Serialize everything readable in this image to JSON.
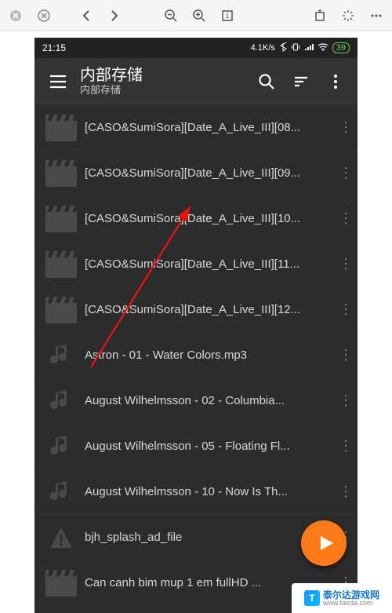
{
  "outer_toolbar": {},
  "status": {
    "time": "21:15",
    "net": "4.1K/s",
    "battery": "39"
  },
  "header": {
    "title": "内部存储",
    "subtitle": "内部存储"
  },
  "files": [
    {
      "type": "video",
      "name": "[CASO&SumiSora][Date_A_Live_III][08..."
    },
    {
      "type": "video",
      "name": "[CASO&SumiSora][Date_A_Live_III][09..."
    },
    {
      "type": "video",
      "name": "[CASO&SumiSora][Date_A_Live_III][10..."
    },
    {
      "type": "video",
      "name": "[CASO&SumiSora][Date_A_Live_III][11..."
    },
    {
      "type": "video",
      "name": "[CASO&SumiSora][Date_A_Live_III][12..."
    },
    {
      "type": "audio",
      "name": "Astron - 01 - Water Colors.mp3"
    },
    {
      "type": "audio",
      "name": "August Wilhelmsson - 02 - Columbia..."
    },
    {
      "type": "audio",
      "name": "August Wilhelmsson - 05 - Floating Fl..."
    },
    {
      "type": "audio",
      "name": "August Wilhelmsson - 10 - Now Is Th..."
    },
    {
      "type": "other",
      "name": "bjh_splash_ad_file"
    },
    {
      "type": "video",
      "name": "Can canh bim mup 1 em fullHD ..."
    }
  ],
  "watermark": {
    "name": "泰尔达游戏网",
    "url": "www.tairda.com"
  }
}
